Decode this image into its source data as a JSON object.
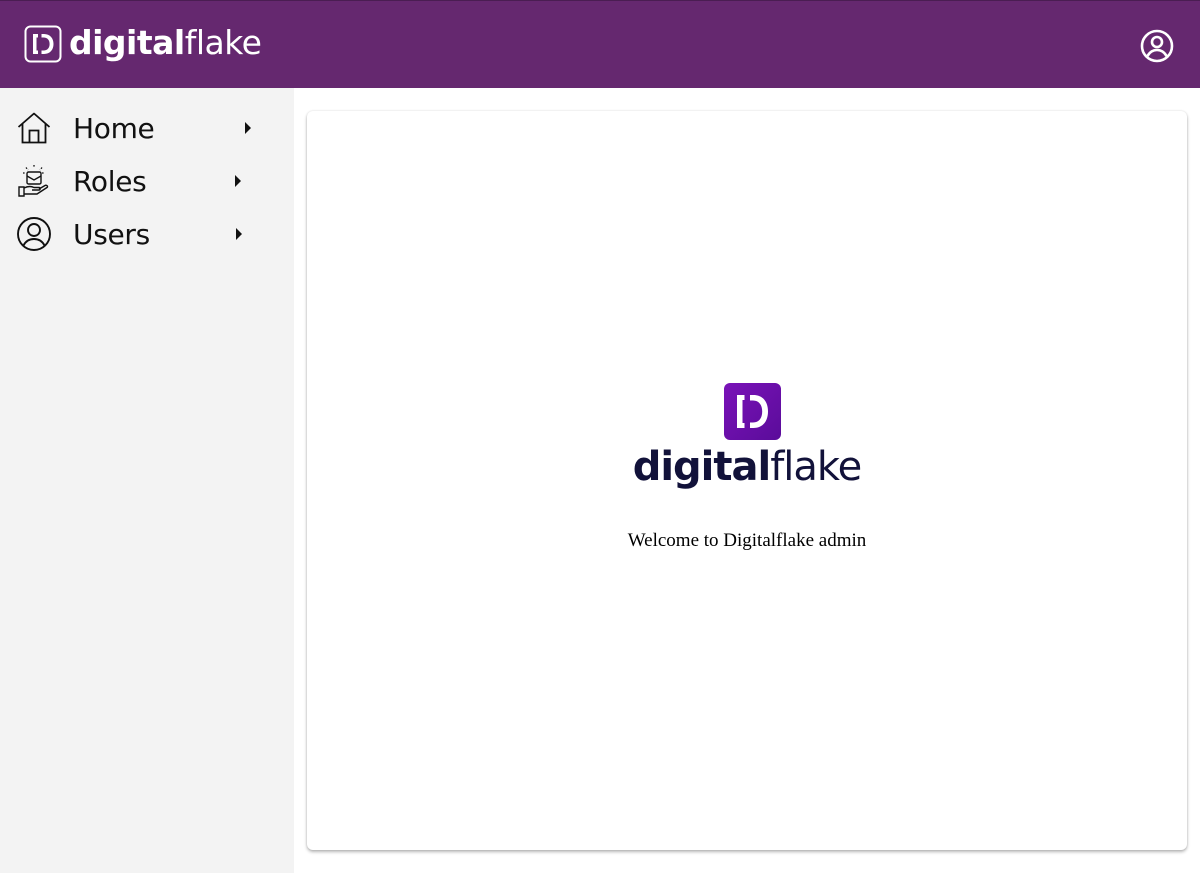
{
  "header": {
    "brand_bold": "digital",
    "brand_light": "flake",
    "account_icon": "account-circle-icon",
    "background": "#65286F"
  },
  "sidebar": {
    "items": [
      {
        "label": "Home",
        "icon": "home-icon"
      },
      {
        "label": "Roles",
        "icon": "roles-icon"
      },
      {
        "label": "Users",
        "icon": "user-circle-icon"
      }
    ]
  },
  "main": {
    "logo_bold": "digital",
    "logo_light": "flake",
    "logo_color": "#6B0FA8",
    "welcome_text": "Welcome to Digitalflake admin"
  }
}
